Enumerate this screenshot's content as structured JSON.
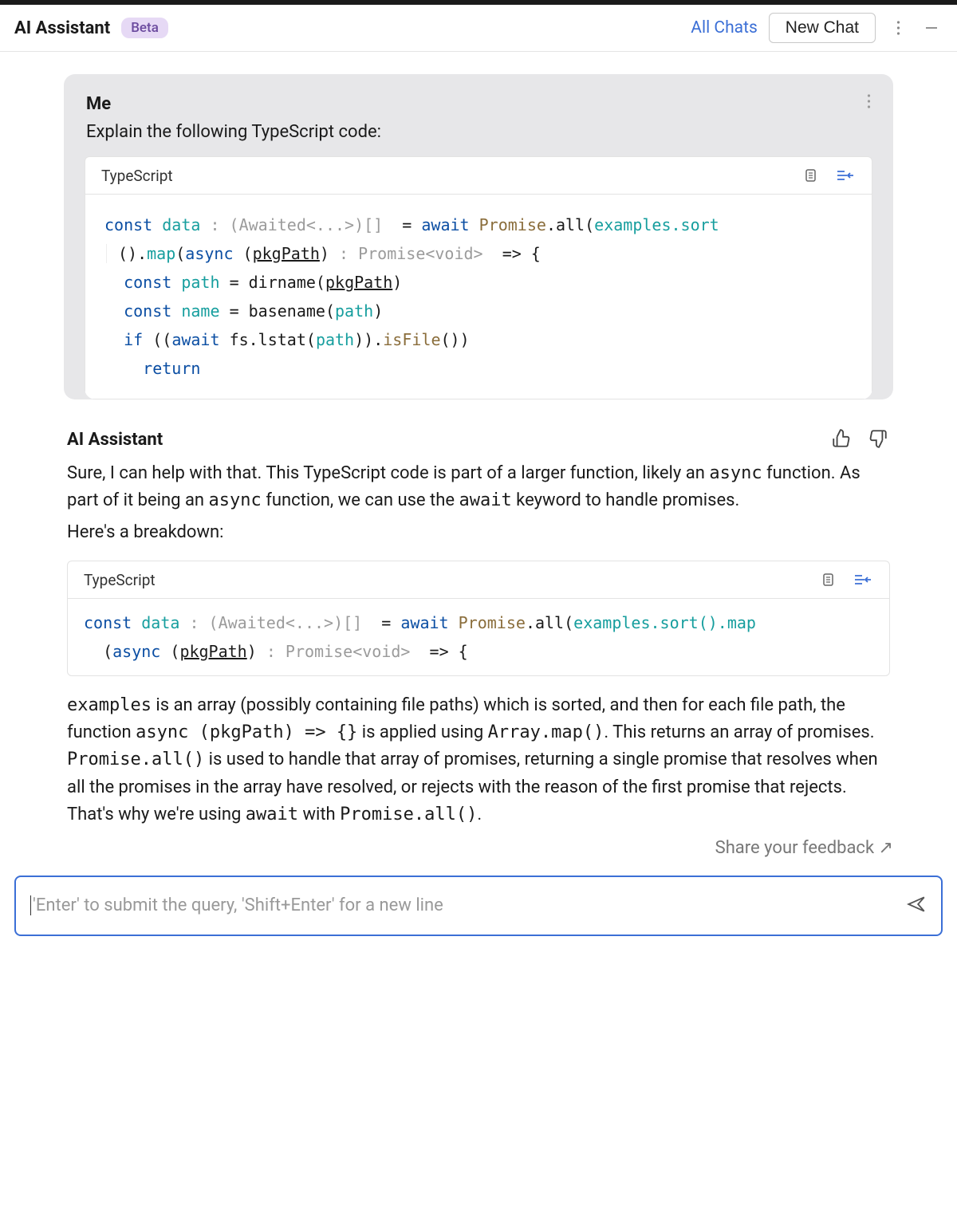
{
  "header": {
    "title": "AI Assistant",
    "badge": "Beta",
    "all_chats": "All Chats",
    "new_chat": "New Chat"
  },
  "me": {
    "label": "Me",
    "question": "Explain the following TypeScript code:",
    "code_lang": "TypeScript"
  },
  "assistant": {
    "label": "AI Assistant",
    "intro_1": "Sure, I can help with that. This TypeScript code is part of a larger function, likely an ",
    "intro_async1": "async",
    "intro_2": " function. As part of it being an ",
    "intro_async2": "async",
    "intro_3": " function, we can use the ",
    "intro_await": "await",
    "intro_4": " keyword to handle promises.",
    "breakdown": "Here's a breakdown:",
    "code_lang": "TypeScript",
    "exp_1a": "examples",
    "exp_1b": " is an array (possibly containing file paths) which is sorted, and then for each file path, the function ",
    "exp_async_sig": "async (pkgPath) => {}",
    "exp_1c": " is applied using ",
    "exp_arraymap": "Array.map()",
    "exp_1d": ". This returns an array of promises. ",
    "exp_promiseall": "Promise.all()",
    "exp_1e": " is used to handle that array of promises, returning a single promise that resolves when all the promises in the array have resolved, or rejects with the reason of the first promise that rejects. That's why we're using ",
    "exp_await2": "await",
    "exp_1f": " with ",
    "exp_promiseall2": "Promise.all()",
    "exp_1g": "."
  },
  "feedback": "Share your feedback ↗",
  "input": {
    "placeholder": "'Enter' to submit the query, 'Shift+Enter' for a new line"
  },
  "code": {
    "me": {
      "l1_const": "const ",
      "l1_data": "data ",
      "l1_ann": ": (Awaited<...>)[]  ",
      "l1_eq": "= ",
      "l1_await": "await ",
      "l1_prom": "Promise",
      "l1_all": ".all(",
      "l1_ex": "examples",
      "l1_sort": ".sort",
      "l2_a": "().",
      "l2_map": "map",
      "l2_b": "(",
      "l2_async": "async ",
      "l2_c": "(",
      "l2_pkg": "pkgPath",
      "l2_d": ") ",
      "l2_ann": ": Promise<void>  ",
      "l2_e": "=> {",
      "l3_const": "const ",
      "l3_path": "path ",
      "l3_eq": "= dirname(",
      "l3_pkg": "pkgPath",
      "l3_end": ")",
      "l4_const": "const ",
      "l4_name": "name ",
      "l4_eq": "= basename(",
      "l4_path": "path",
      "l4_end": ")",
      "l5_if": "if ",
      "l5_a": "((",
      "l5_await": "await ",
      "l5_b": "fs.lstat(",
      "l5_path": "path",
      "l5_c": ")).",
      "l5_isfile": "isFile",
      "l5_d": "())",
      "l6_return": "return"
    },
    "assist": {
      "l1_const": "const ",
      "l1_data": "data ",
      "l1_ann": ": (Awaited<...>)[]  ",
      "l1_eq": "= ",
      "l1_await": "await ",
      "l1_prom": "Promise",
      "l1_all": ".all(",
      "l1_ex": "examples",
      "l1_sort": ".sort()",
      "l1_map": ".map",
      "l2_a": "(",
      "l2_async": "async ",
      "l2_b": "(",
      "l2_pkg": "pkgPath",
      "l2_c": ") ",
      "l2_ann": ": Promise<void>  ",
      "l2_d": "=> {"
    }
  }
}
